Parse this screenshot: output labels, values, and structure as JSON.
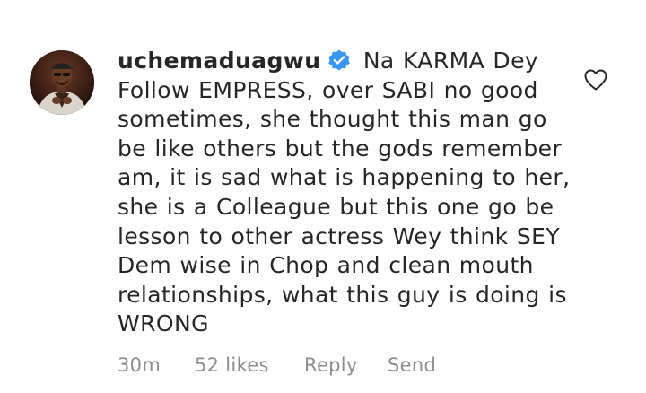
{
  "comment": {
    "username": "uchemaduagwu",
    "verified_icon": "verified-badge-icon",
    "text": "Na KARMA Dey Follow EMPRESS, over SABI no good sometimes, she thought this man go be like others but the gods remember am, it is sad what is happening to her, she is a Colleague but this one go be lesson to other actress Wey think SEY Dem wise in Chop and clean mouth relationships, what this guy is doing is WRONG",
    "time_ago": "30m",
    "likes": "52 likes",
    "reply_label": "Reply",
    "send_label": "Send",
    "like_icon": "heart-outline-icon",
    "colors": {
      "text": "#262626",
      "meta": "#8e8e8e",
      "verified": "#3897f0"
    }
  }
}
